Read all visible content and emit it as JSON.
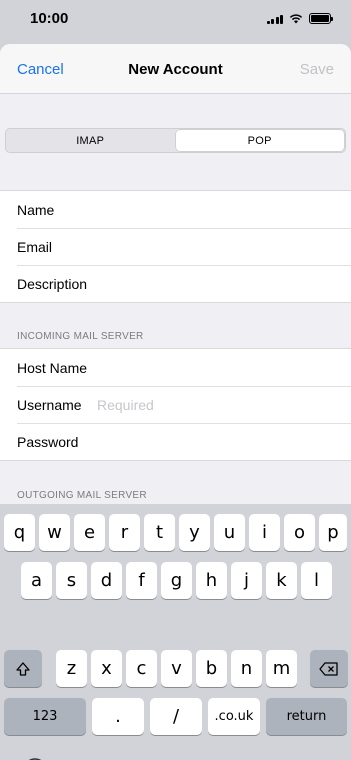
{
  "status": {
    "time": "10:00"
  },
  "nav": {
    "cancel": "Cancel",
    "title": "New Account",
    "save": "Save"
  },
  "segmented": {
    "options": [
      "IMAP",
      "POP"
    ],
    "selected": "POP"
  },
  "account_fields": [
    "Name",
    "Email",
    "Description"
  ],
  "incoming": {
    "header": "INCOMING MAIL SERVER",
    "host": "Host Name",
    "username": "Username",
    "username_placeholder": "Required",
    "password": "Password"
  },
  "outgoing": {
    "header": "OUTGOING MAIL SERVER"
  },
  "keyboard": {
    "row1": [
      "q",
      "w",
      "e",
      "r",
      "t",
      "y",
      "u",
      "i",
      "o",
      "p"
    ],
    "row2": [
      "a",
      "s",
      "d",
      "f",
      "g",
      "h",
      "j",
      "k",
      "l"
    ],
    "row3": [
      "z",
      "x",
      "c",
      "v",
      "b",
      "n",
      "m"
    ],
    "numbers": "123",
    "period": ".",
    "slash": "/",
    "couk": ".co.uk",
    "return": "return"
  },
  "colors": {
    "accent": "#1a73e8",
    "disabled": "#c2c2c6"
  }
}
